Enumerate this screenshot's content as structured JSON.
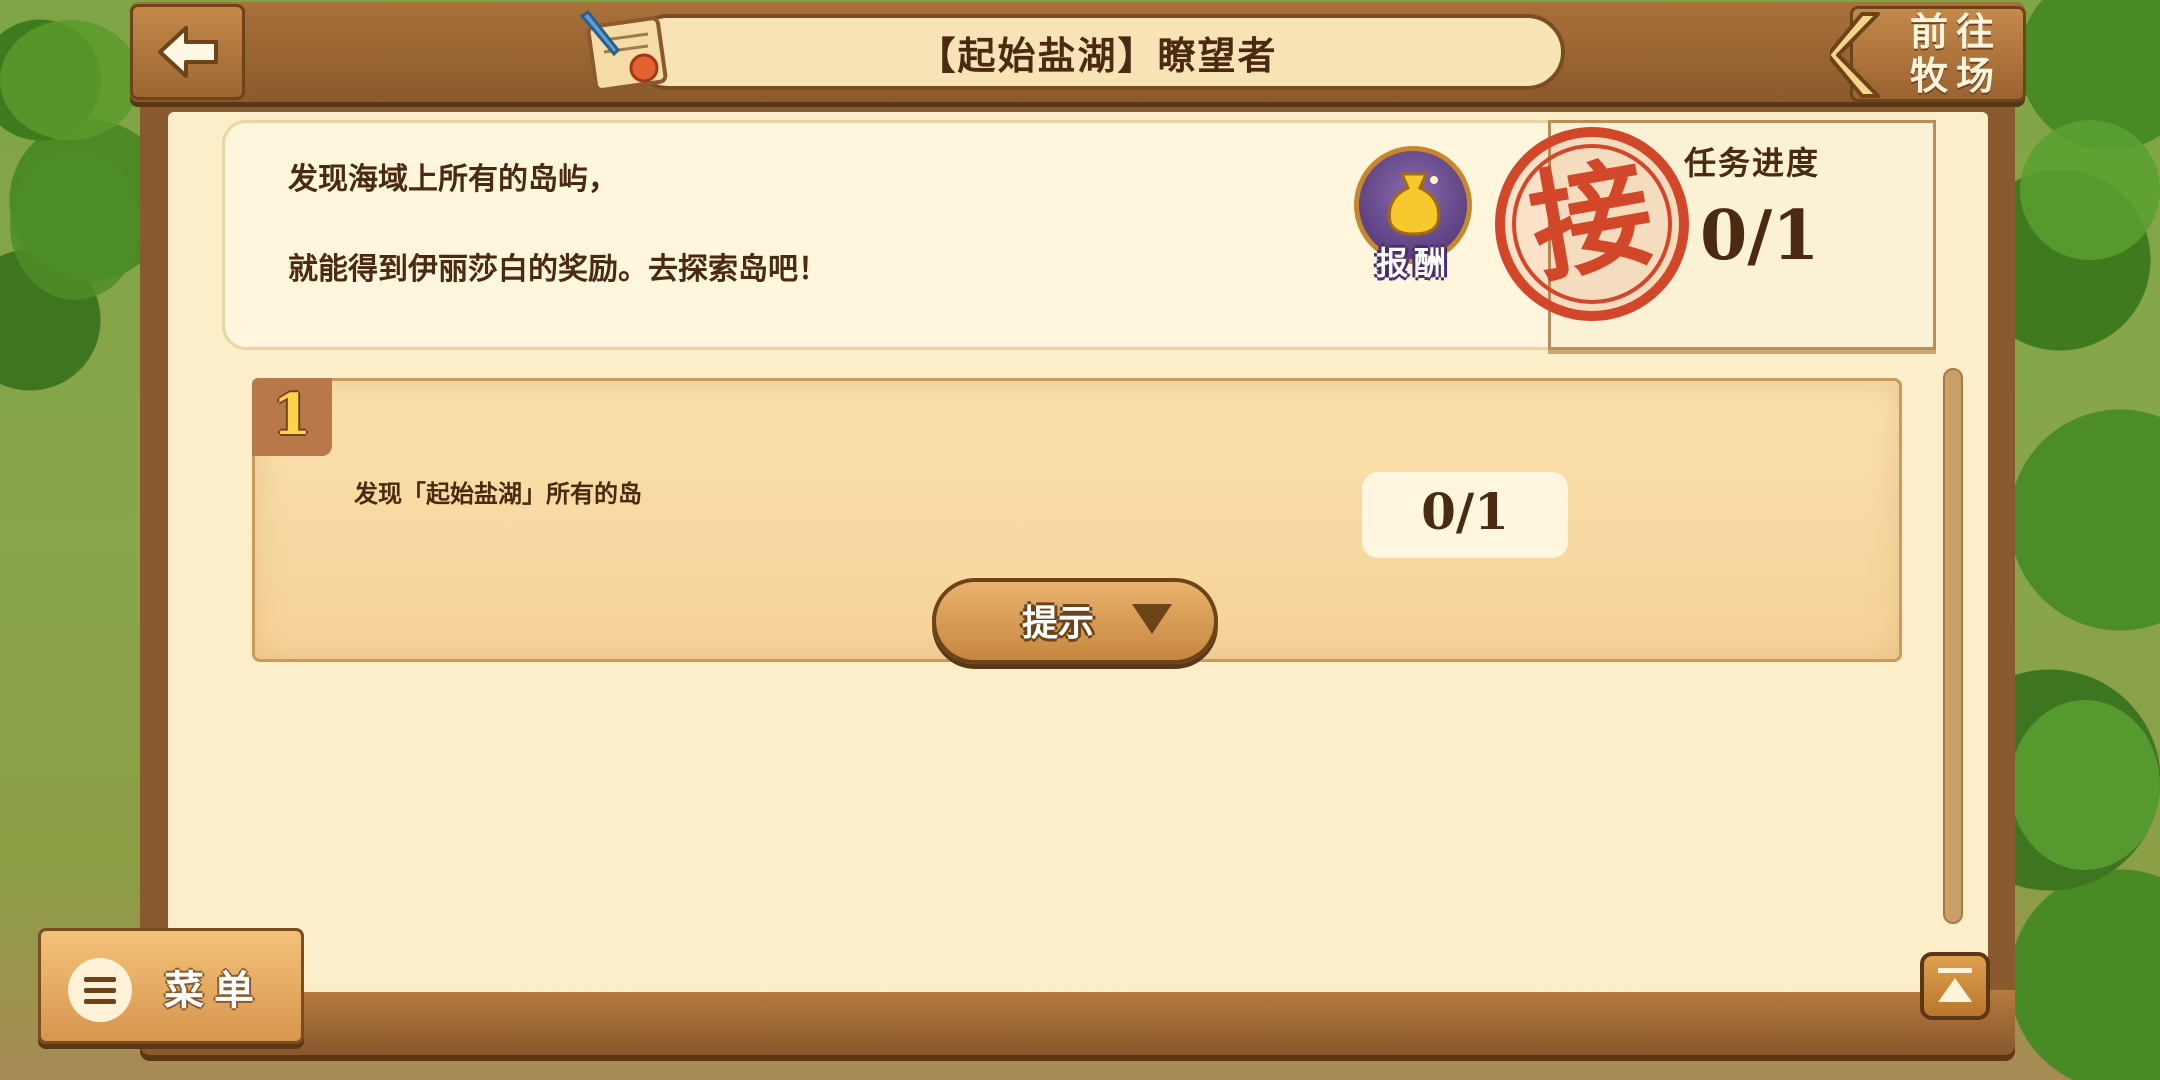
{
  "header": {
    "title": "【起始盐湖】瞭望者",
    "goto_label_line1": "前往",
    "goto_label_line2": "牧场"
  },
  "description": {
    "line1": "发现海域上所有的岛屿，",
    "line2": "就能得到伊丽莎白的奖励。去探索岛吧！"
  },
  "reward": {
    "label": "报酬",
    "icon": "money-bag-icon"
  },
  "stamp": {
    "text": "接"
  },
  "progress": {
    "label": "任务进度",
    "value": "0/1"
  },
  "tasks": [
    {
      "number": "1",
      "text": "发现「起始盐湖」所有的岛",
      "count": "0/1",
      "hint_label": "提示"
    }
  ],
  "menu": {
    "label": "菜单"
  },
  "colors": {
    "wood": "#8a5a2e",
    "parchment": "#fbeec9",
    "text": "#4a2a10",
    "stamp_red": "#d2462a"
  }
}
